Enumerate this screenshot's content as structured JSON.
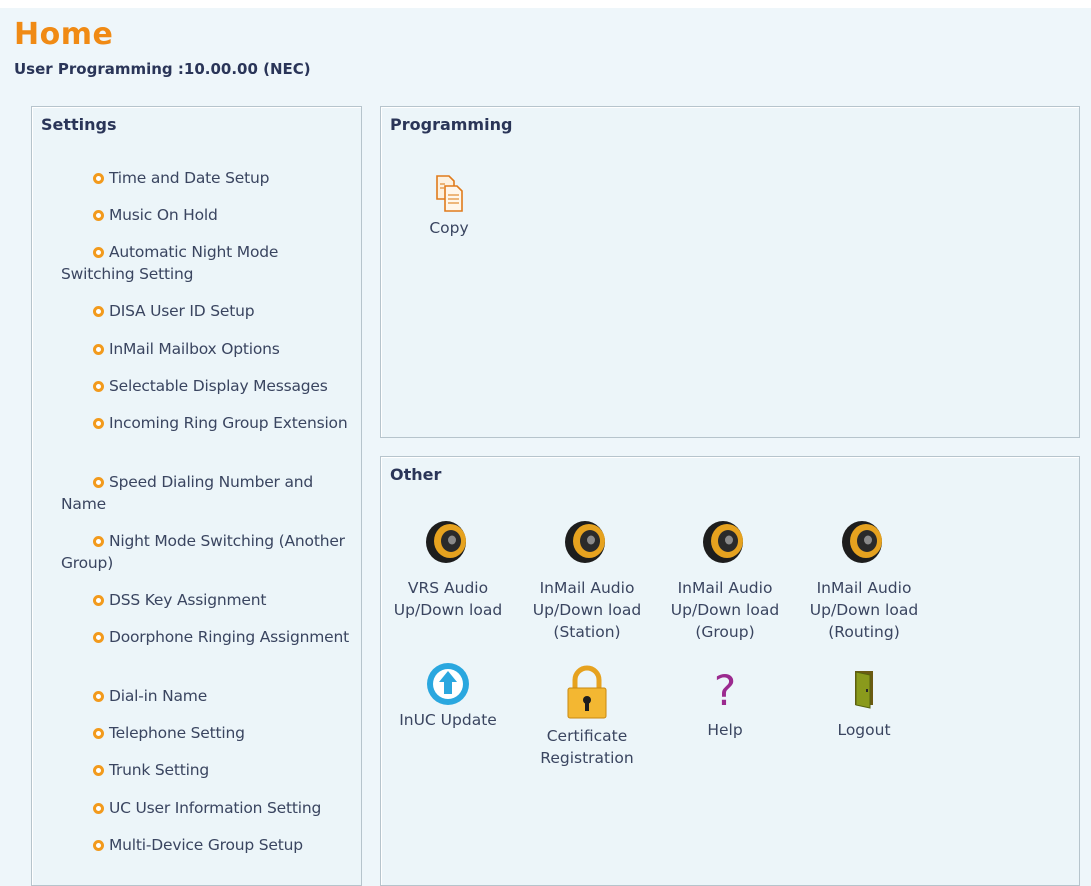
{
  "header": {
    "title": "Home",
    "subtitle": "User Programming :10.00.00 (NEC)"
  },
  "settings": {
    "title": "Settings",
    "items": [
      "Time and Date Setup",
      "Music On Hold",
      "Automatic Night Mode Switching Setting",
      "DISA User ID Setup",
      "InMail Mailbox Options",
      "Selectable Display Messages",
      "Incoming Ring Group Extension",
      "Speed Dialing Number and Name",
      "Night Mode Switching (Another Group)",
      "DSS Key Assignment",
      "Doorphone Ringing Assignment",
      "Dial-in Name",
      "Telephone Setting",
      "Trunk Setting",
      "UC User Information Setting",
      "Multi-Device Group Setup"
    ]
  },
  "programming": {
    "title": "Programming",
    "copy_label": "Copy"
  },
  "other": {
    "title": "Other",
    "tiles": [
      {
        "label": "VRS Audio\nUp/Down load",
        "icon": "speaker-icon"
      },
      {
        "label": "InMail Audio\nUp/Down load\n(Station)",
        "icon": "speaker-icon"
      },
      {
        "label": "InMail Audio\nUp/Down load\n(Group)",
        "icon": "speaker-icon"
      },
      {
        "label": "InMail Audio\nUp/Down load\n(Routing)",
        "icon": "speaker-icon"
      },
      {
        "label": "InUC Update",
        "icon": "upload-arrow-icon"
      },
      {
        "label": "Certificate\nRegistration",
        "icon": "padlock-icon"
      },
      {
        "label": "Help",
        "icon": "question-mark-icon"
      },
      {
        "label": "Logout",
        "icon": "door-icon"
      }
    ]
  },
  "colors": {
    "title_orange": "#f08a14",
    "bullet_orange": "#f29a1c",
    "background": "#eef6fa",
    "text_navy": "#2a3558"
  }
}
